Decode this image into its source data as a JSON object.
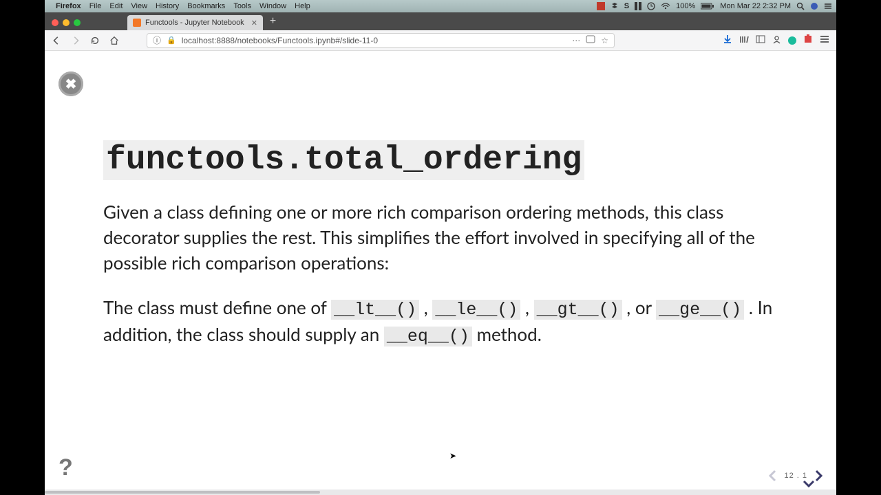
{
  "mac": {
    "app": "Firefox",
    "menus": [
      "File",
      "Edit",
      "View",
      "History",
      "Bookmarks",
      "Tools",
      "Window",
      "Help"
    ],
    "battery": "100%",
    "clock": "Mon Mar 22  2:32 PM"
  },
  "tab": {
    "title": "Functools - Jupyter Notebook"
  },
  "url": {
    "address": "localhost:8888/notebooks/Functools.ipynb#/slide-11-0"
  },
  "slide": {
    "heading": "functools.total_ordering",
    "para1": "Given a class defining one or more rich comparison ordering methods, this class decorator supplies the rest. This simplifies the effort involved in specifying all of the possible rich comparison operations:",
    "para2_a": "The class must define one of ",
    "code_lt": "__lt__()",
    "sep1": ", ",
    "code_le": "__le__()",
    "sep2": ", ",
    "code_gt": "__gt__()",
    "sep3": ", or ",
    "code_ge": "__ge__()",
    "para2_b": ". In addition, the class should supply an ",
    "code_eq": "__eq__()",
    "para2_c": " method.",
    "counter": "12 . 1",
    "help": "?"
  }
}
